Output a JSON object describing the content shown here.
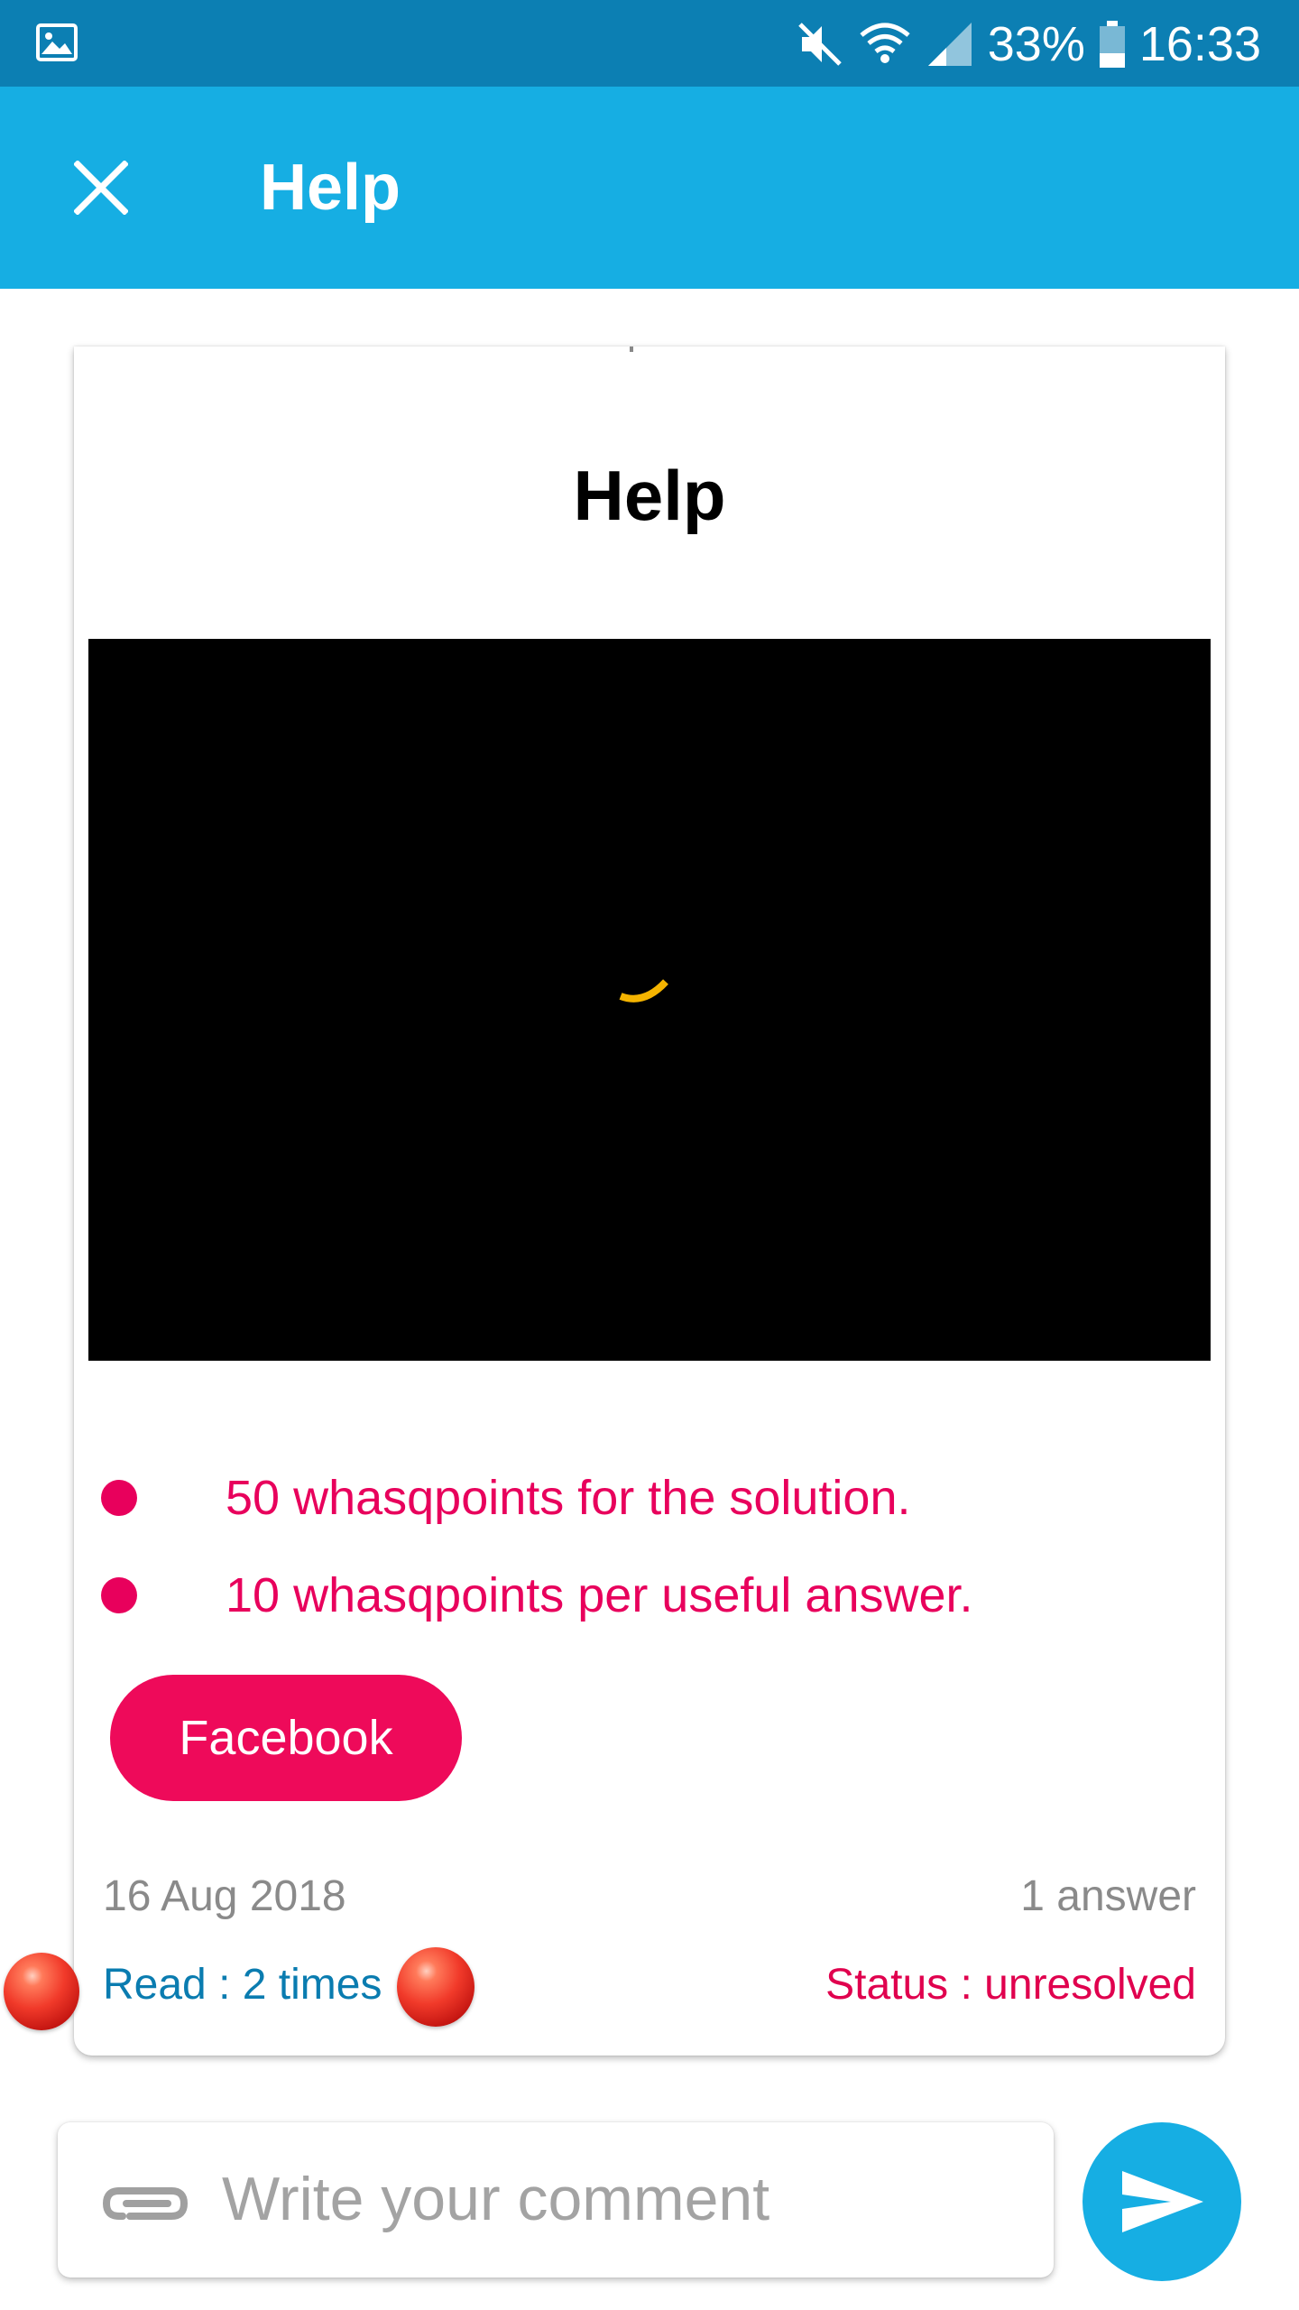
{
  "status_bar": {
    "battery": "33%",
    "time": "16:33",
    "icons": [
      "gallery-icon",
      "mute-icon",
      "wifi-icon",
      "signal-icon",
      "battery-icon"
    ]
  },
  "app_bar": {
    "title": "Help",
    "close_icon": "close-icon"
  },
  "card": {
    "title": "Help",
    "video": {
      "state": "loading"
    },
    "bullets": [
      {
        "text": "50 whasqpoints for the solution."
      },
      {
        "text": "10 whasqpoints per useful answer."
      }
    ],
    "facebook_button": "Facebook",
    "date": "16 Aug 2018",
    "answers": "1 answer",
    "read": "Read : 2 times",
    "status": "Status : unresolved"
  },
  "comment": {
    "placeholder": "Write your comment",
    "value": ""
  },
  "colors": {
    "status_bar": "#0c7fb3",
    "app_bar": "#16aee3",
    "accent_pink": "#e8005c",
    "link_blue": "#0a7cb0",
    "muted_gray": "#8a8a8a",
    "spinner": "#f5b400"
  }
}
